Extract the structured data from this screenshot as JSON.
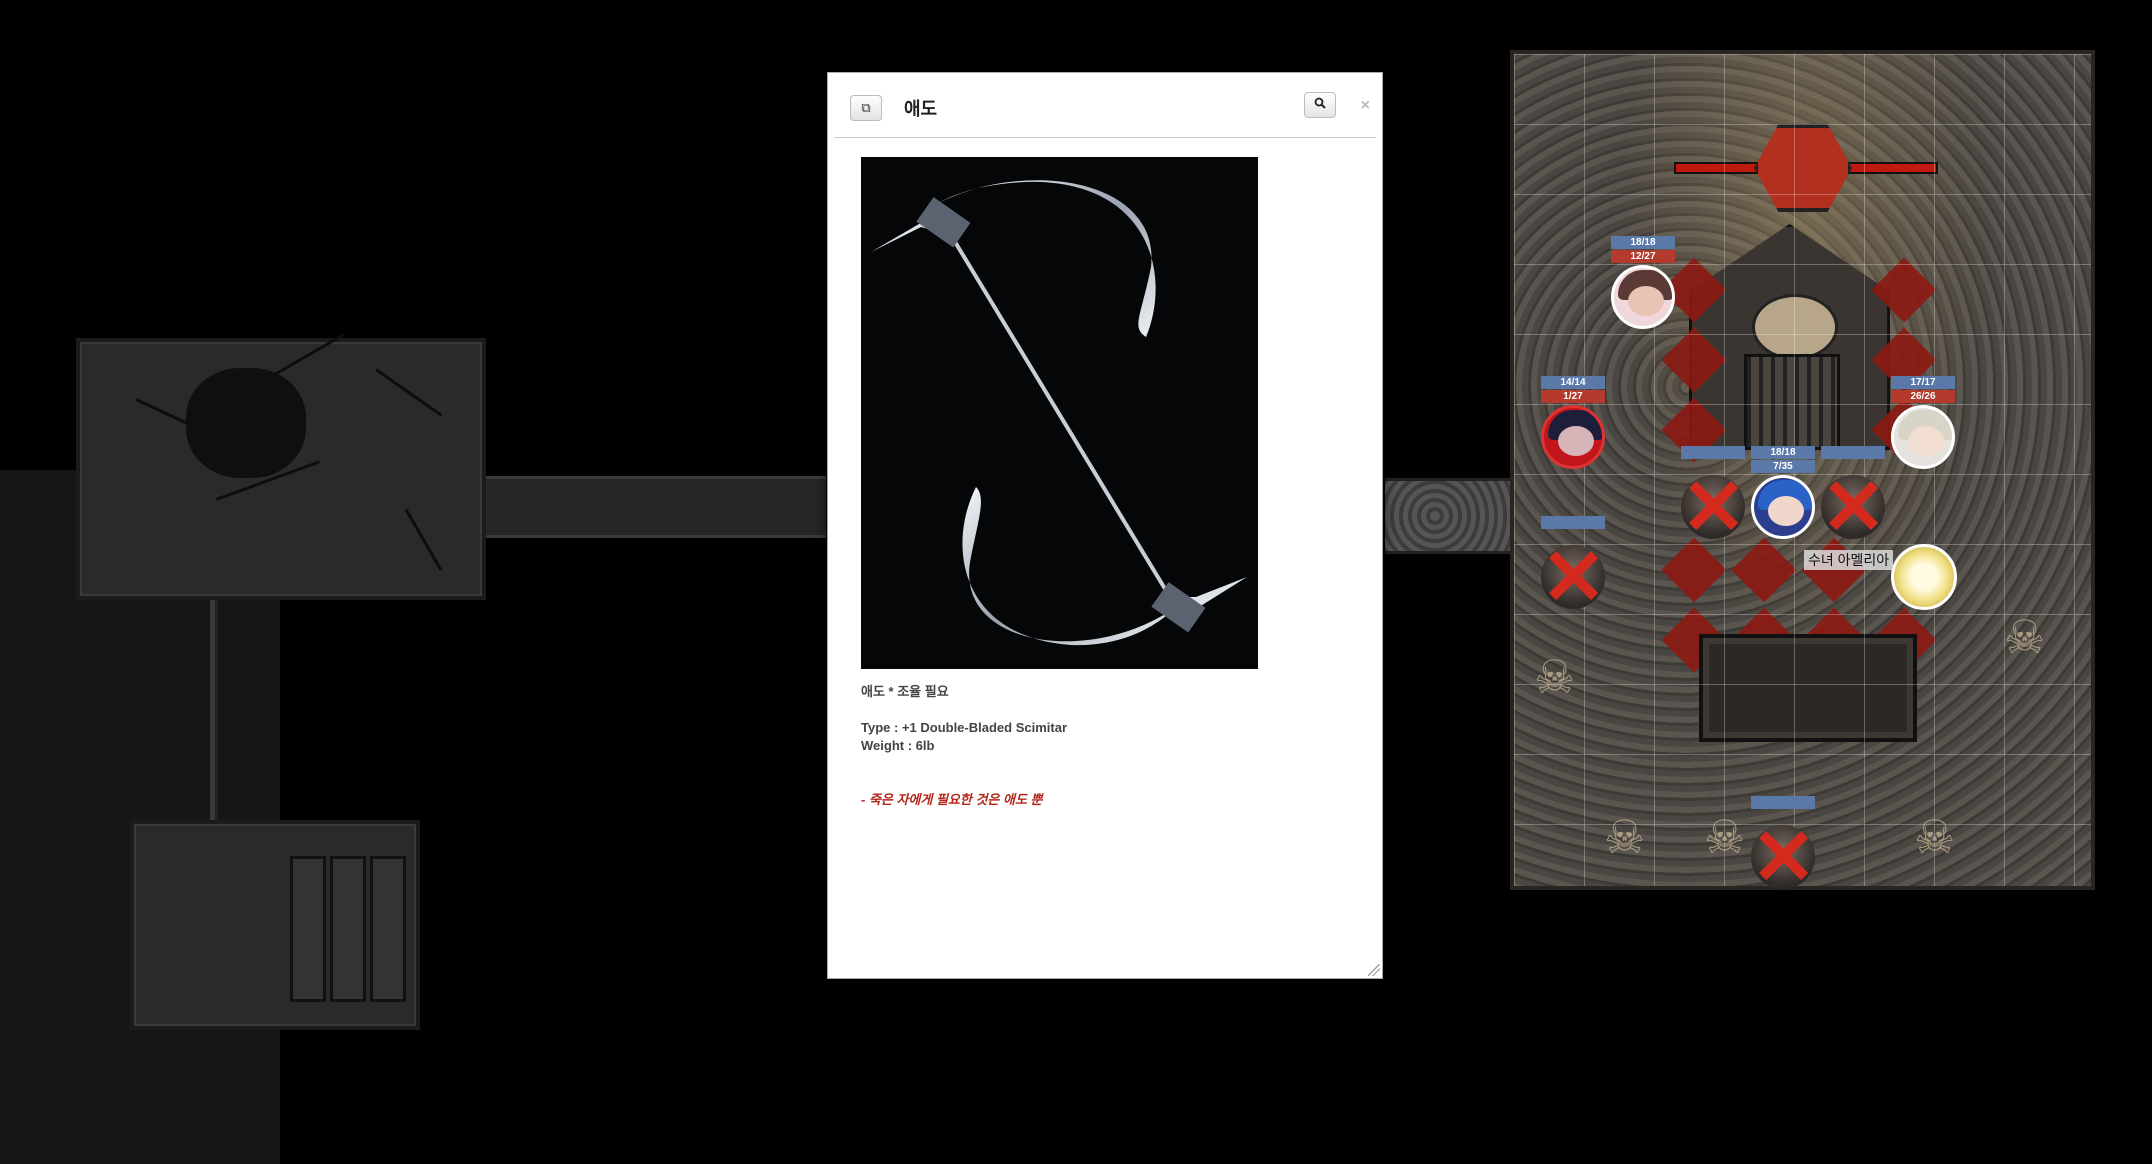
{
  "dialog": {
    "title": "애도",
    "popout_icon": "popout-icon",
    "search_icon": "search-icon",
    "close_glyph": "×",
    "image_alt": "Double-bladed scimitar artwork",
    "line1": "애도 * 조율 필요",
    "type_line": "Type : +1  Double-Bladed Scimitar",
    "weight_line": "Weight : 6lb",
    "quote": "- 죽은 자에게 필요한 것은 애도 뿐",
    "quote_color": "#b2271a"
  },
  "tokens": [
    {
      "id": "token-1",
      "hp": "18/18",
      "sub": "12/27"
    },
    {
      "id": "token-2",
      "hp": "14/14",
      "sub": "1/27"
    },
    {
      "id": "token-3",
      "hp": "17/17",
      "sub": "26/26"
    },
    {
      "id": "token-4",
      "hp": "18/18",
      "sub": "7/35"
    }
  ],
  "npc_label": "수녀 아멜리아",
  "colors": {
    "hp_blue": "#5a78a8",
    "hp_red": "#b33a2d",
    "floor_red": "#8b1a14",
    "dead_marker": "#d42a1e"
  }
}
